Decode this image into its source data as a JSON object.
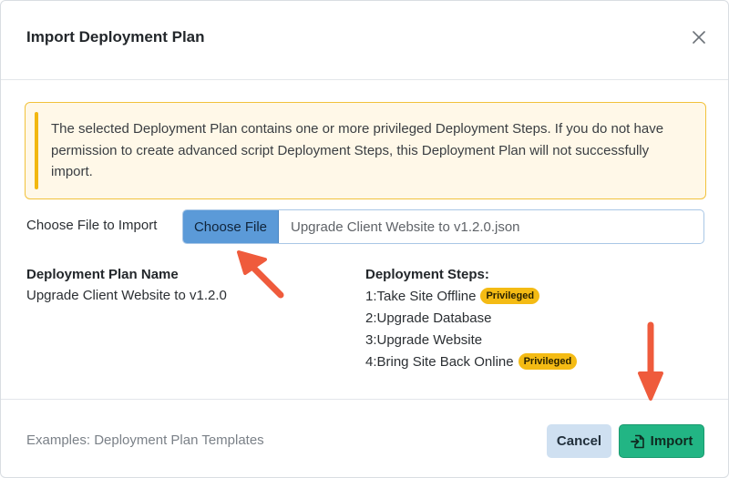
{
  "dialog": {
    "title": "Import Deployment Plan",
    "close_icon": "close-icon"
  },
  "alert": {
    "message": "The selected Deployment Plan contains one or more privileged Deployment Steps. If you do not have permission to create advanced script Deployment Steps, this Deployment Plan will not successfully import.",
    "accent_color": "#f2b710"
  },
  "file_import": {
    "label": "Choose File to Import",
    "button_label": "Choose File",
    "file_name": "Upgrade Client Website to v1.2.0.json"
  },
  "plan": {
    "name_heading": "Deployment Plan Name",
    "name_value": "Upgrade Client Website to v1.2.0"
  },
  "steps": {
    "heading": "Deployment Steps:",
    "items": [
      {
        "label": "1:Take Site Offline",
        "badge": "Privileged"
      },
      {
        "label": "2:Upgrade Database",
        "badge": ""
      },
      {
        "label": "3:Upgrade Website",
        "badge": ""
      },
      {
        "label": "4:Bring Site Back Online",
        "badge": "Privileged"
      }
    ]
  },
  "footer": {
    "examples_link": "Examples: Deployment Plan Templates",
    "cancel_label": "Cancel",
    "import_label": "Import",
    "import_icon": "file-import-icon"
  },
  "colors": {
    "primary": "#5b9ad8",
    "success": "#22b584",
    "badge": "#f4bb14",
    "annotation_arrow": "#ef5b3c"
  }
}
